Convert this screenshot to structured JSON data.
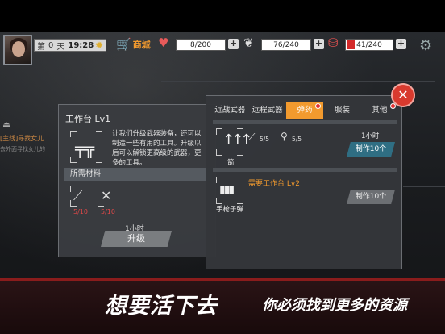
{
  "hud": {
    "day_label": "第",
    "day_number": "0",
    "day_suffix": "天",
    "time": "19:28",
    "shop_label": "商城",
    "health": "8/200",
    "stomach": "76/240",
    "thirst": "41/240"
  },
  "left_quest": {
    "line1": "[主线]寻找女儿",
    "line2": "去外面寻找女儿的"
  },
  "workbench": {
    "title": "工作台 Lv1",
    "description": "让我们升级武器装备，还可以制造一些有用的工具。升级以后可以解锁更高级的武器，更多的工具。",
    "required_label": "所需材料",
    "materials": [
      {
        "icon": "pipe-icon",
        "count": "5/10"
      },
      {
        "icon": "wrench-icon",
        "count": "5/10"
      }
    ],
    "time": "1小时",
    "upgrade_label": "升级"
  },
  "crafting": {
    "tabs": [
      "近战武器",
      "远程武器",
      "弹药",
      "服装",
      "其他"
    ],
    "active_tab": 2,
    "items": [
      {
        "name": "箭",
        "materials": [
          {
            "icon": "pipe-icon",
            "count": "5/5"
          },
          {
            "icon": "screw-icon",
            "count": "5/5"
          }
        ],
        "time": "1小时",
        "button_label": "制作10个"
      },
      {
        "name": "手枪子弹",
        "requirement": "需要工作台 Lv2",
        "button_label": "制作10个"
      }
    ]
  },
  "banner": {
    "slogan_main": "想要活下去",
    "slogan_sub": "你必须找到更多的资源"
  },
  "colors": {
    "accent": "#f29a2e",
    "missing": "#e04848",
    "craft_enabled": "#2f6e83"
  }
}
